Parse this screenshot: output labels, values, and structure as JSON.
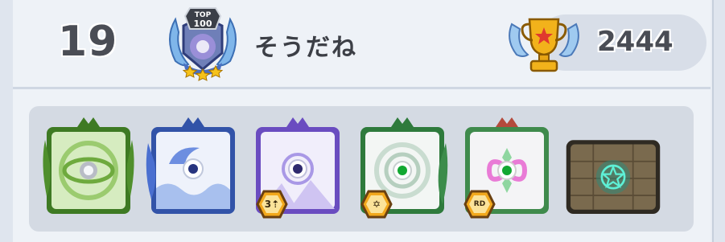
{
  "player": {
    "rank": "19",
    "name": "そうだね",
    "badge_text_top": "TOP",
    "badge_text_num": "100",
    "trophies": "2444"
  },
  "team": [
    {
      "name": "summoner",
      "element": "earth",
      "color": "#5f9a2e"
    },
    {
      "name": "water-card",
      "element": "water",
      "color": "#3f63c8"
    },
    {
      "name": "arcane-card",
      "element": "arcane",
      "color": "#7b5ac9",
      "level_badge": "3⇡"
    },
    {
      "name": "life-card",
      "element": "life",
      "color": "#3f8a4c",
      "level_badge": "✡"
    },
    {
      "name": "rainbow-card",
      "element": "dragon",
      "color": "#b44a3c",
      "level_badge": "RD"
    },
    {
      "name": "ruleset-card",
      "element": "ruleset",
      "color": "#6b5a3e"
    }
  ],
  "colors": {
    "accent_gold": "#f2b21b",
    "text_dark": "#4a4d55"
  }
}
